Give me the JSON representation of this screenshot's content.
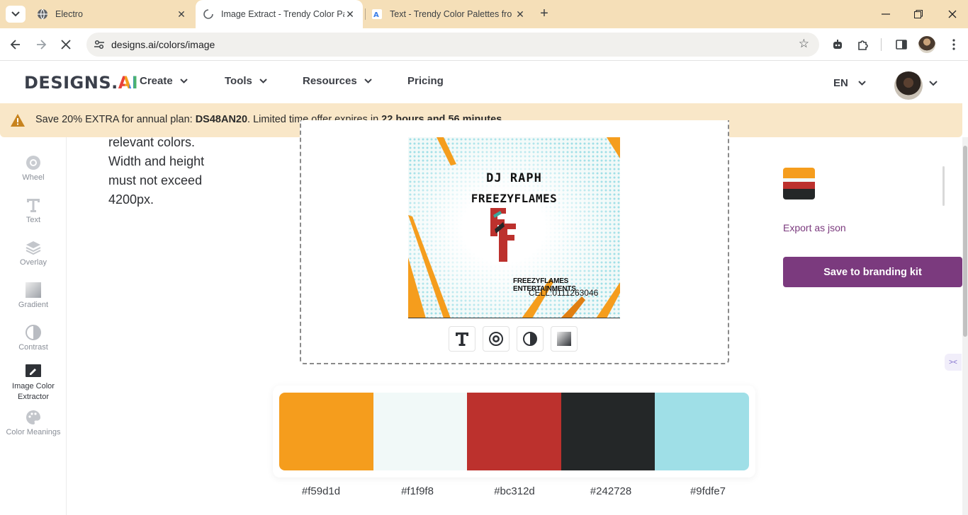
{
  "browser": {
    "tabs": [
      {
        "title": "Electro",
        "active": false
      },
      {
        "title": "Image Extract - Trendy Color Pa",
        "active": true
      },
      {
        "title": "Text - Trendy Color Palettes fro",
        "active": false
      }
    ],
    "url": "designs.ai/colors/image"
  },
  "site": {
    "logo_text": "DESIGNS.",
    "logo_ai": "AI",
    "nav": [
      {
        "label": "Create",
        "has_dropdown": true
      },
      {
        "label": "Tools",
        "has_dropdown": true
      },
      {
        "label": "Resources",
        "has_dropdown": true
      },
      {
        "label": "Pricing",
        "has_dropdown": false
      }
    ],
    "language": "EN"
  },
  "banner": {
    "prefix": "Save 20% EXTRA for annual plan: ",
    "code": "DS48AN20",
    "middle": ". Limited time offer expires in ",
    "countdown": "22 hours and 56 minutes"
  },
  "sidebar": {
    "items": [
      {
        "label": "Wheel",
        "icon": "wheel-icon"
      },
      {
        "label": "Text",
        "icon": "text-icon"
      },
      {
        "label": "Overlay",
        "icon": "layers-icon"
      },
      {
        "label": "Gradient",
        "icon": "gradient-icon"
      },
      {
        "label": "Contrast",
        "icon": "contrast-icon"
      },
      {
        "label": "Image Color\nExtractor",
        "icon": "picker-icon",
        "active": true
      },
      {
        "label": "Color Meanings",
        "icon": "palette-icon"
      }
    ]
  },
  "instructions": "relevant colors. Width and height must not exceed 4200px.",
  "preview_image": {
    "line1": "DJ RAPH",
    "line2": "FREEZYFLAMES",
    "monogram": "FF",
    "company": "FREEZYFLAMES ENTERTAINMENTS",
    "cell": "CELL:0111263046"
  },
  "image_tools": [
    "text-tool-icon",
    "wheel-tool-icon",
    "contrast-tool-icon",
    "gradient-tool-icon"
  ],
  "palette": {
    "colors": [
      {
        "hex": "#f59d1d"
      },
      {
        "hex": "#f1f9f8"
      },
      {
        "hex": "#bc312d"
      },
      {
        "hex": "#242728"
      },
      {
        "hex": "#9fdfe7"
      }
    ]
  },
  "right_panel": {
    "mini_palette": [
      "#f59d1d",
      "#f1f9f8",
      "#bc312d",
      "#242728"
    ],
    "export_label": "Export as json",
    "save_label": "Save to branding kit"
  }
}
